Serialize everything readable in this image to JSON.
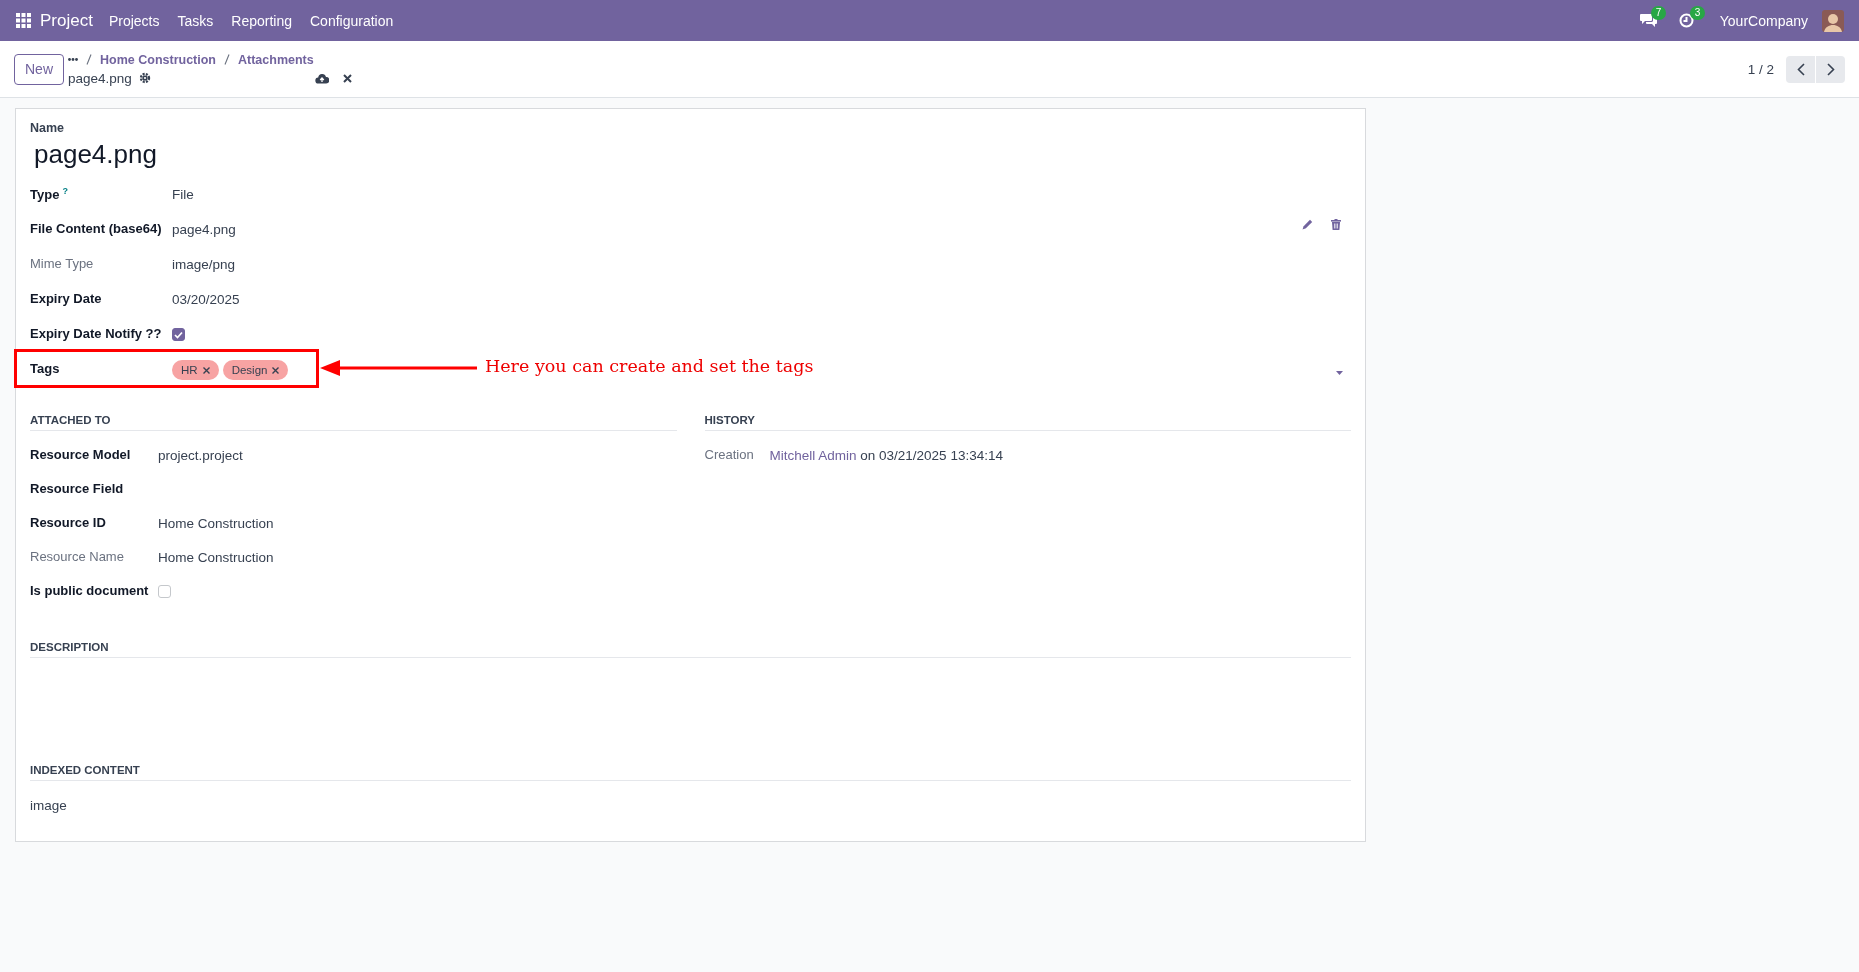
{
  "navbar": {
    "app": "Project",
    "menu": [
      "Projects",
      "Tasks",
      "Reporting",
      "Configuration"
    ],
    "messages_count": "7",
    "activities_count": "3",
    "company": "YourCompany"
  },
  "control_panel": {
    "new_button": "New",
    "breadcrumbs": [
      "Home Construction",
      "Attachments"
    ],
    "record_name": "page4.png",
    "pager": "1 / 2"
  },
  "form": {
    "name_label": "Name",
    "name": "page4.png",
    "fields": [
      {
        "kind": "text",
        "label": "Type",
        "help": "?",
        "value": "File",
        "readonly": false
      },
      {
        "kind": "file",
        "label": "File Content (base64)",
        "value": "page4.png",
        "readonly": false
      },
      {
        "kind": "text",
        "label": "Mime Type",
        "value": "image/png",
        "readonly": true
      },
      {
        "kind": "text",
        "label": "Expiry Date",
        "value": "03/20/2025",
        "readonly": false
      },
      {
        "kind": "checkbox",
        "label": "Expiry Date Notify ??",
        "checked": true,
        "readonly": false
      },
      {
        "kind": "tags",
        "label": "Tags",
        "readonly": false,
        "tags": [
          {
            "label": "HR",
            "color": "#f7a3a3"
          },
          {
            "label": "Design",
            "color": "#f7a3a3"
          }
        ]
      }
    ],
    "attached_to": {
      "title": "ATTACHED TO",
      "fields": [
        {
          "kind": "text",
          "label": "Resource Model",
          "value": "project.project",
          "readonly": false
        },
        {
          "kind": "text",
          "label": "Resource Field",
          "readonly": false
        },
        {
          "kind": "text",
          "label": "Resource ID",
          "value": "Home Construction",
          "readonly": false
        },
        {
          "kind": "text",
          "label": "Resource Name",
          "value": "Home Construction",
          "readonly": true
        },
        {
          "kind": "checkbox",
          "label": "Is public document",
          "checked": false,
          "readonly": false
        }
      ]
    },
    "history": {
      "title": "HISTORY",
      "fields": [
        {
          "kind": "creation",
          "label": "Creation",
          "user": "Mitchell Admin",
          "value": "on 03/21/2025 13:34:14",
          "readonly": true
        }
      ]
    },
    "description": {
      "title": "DESCRIPTION"
    },
    "indexed_content": {
      "title": "INDEXED CONTENT",
      "value": "image"
    }
  },
  "annotation": {
    "text": "Here you can create and set the tags"
  }
}
